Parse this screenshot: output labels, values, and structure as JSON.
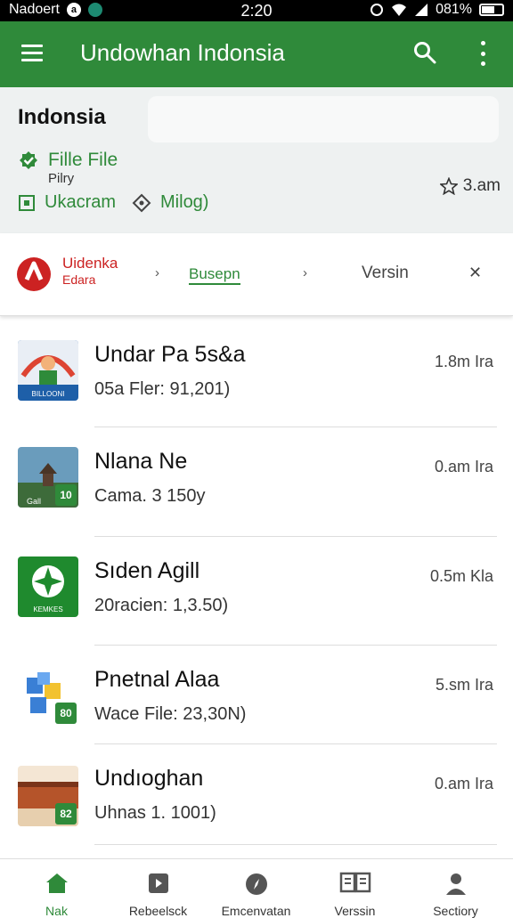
{
  "status_bar": {
    "carrier": "Nadoert",
    "time": "2:20",
    "battery": "081%"
  },
  "app_bar": {
    "title": "Undowhan Indonsia"
  },
  "header": {
    "title": "Indonsia",
    "row1_label": "Fille File",
    "row1_sub": "Pilry",
    "row2_label_a": "Ukacram",
    "row2_label_b": "Milog)",
    "rating": "3.am"
  },
  "filters": {
    "brand_line1": "Uidenka",
    "brand_line2": "Edara",
    "active": "Busepn",
    "version": "Versin"
  },
  "items": [
    {
      "name": "Undar Pa 5s&a",
      "sub": "05a Fler: 91,201)",
      "size": "1.8m Ira",
      "badge": ""
    },
    {
      "name": "Nlana Ne",
      "sub": "Cama. 3 150y",
      "size": "0.am Ira",
      "badge": "10"
    },
    {
      "name": "Sıden Agill",
      "sub": "20racien: 1,3.50)",
      "size": "0.5m Kla",
      "badge": ""
    },
    {
      "name": "Pnetnal Alaa",
      "sub": "Wace File: 23,30N)",
      "size": "5.sm Ira",
      "badge": "80"
    },
    {
      "name": "Undıoghan",
      "sub": "Uhnas 1. 1001)",
      "size": "0.am Ira",
      "badge": "82"
    }
  ],
  "bottom_nav": [
    {
      "label": "Nak"
    },
    {
      "label": "Rebeelsck"
    },
    {
      "label": "Emcenvatan"
    },
    {
      "label": "Verssin"
    },
    {
      "label": "Sectiory"
    }
  ],
  "colors": {
    "primary": "#2f8a3a",
    "brand_red": "#cc2222",
    "header_bg": "#eef1f1"
  }
}
